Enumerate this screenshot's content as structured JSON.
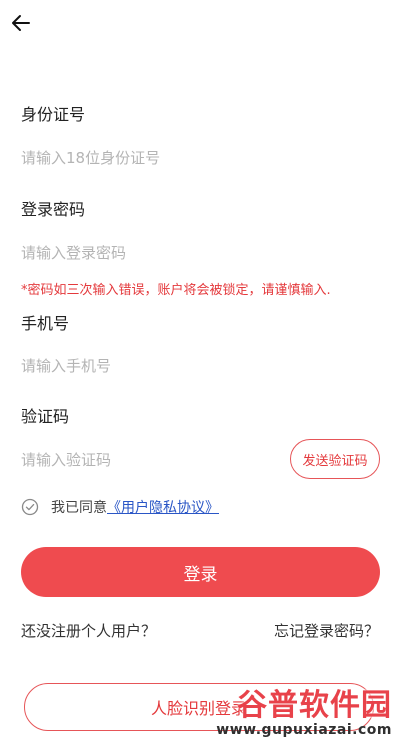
{
  "header": {
    "back_icon": "arrow-left-icon"
  },
  "form": {
    "id_label": "身份证号",
    "id_placeholder": "请输入18位身份证号",
    "password_label": "登录密码",
    "password_placeholder": "请输入登录密码",
    "password_warning": "*密码如三次输入错误，账户将会被锁定，请谨慎输入.",
    "phone_label": "手机号",
    "phone_placeholder": "请输入手机号",
    "code_label": "验证码",
    "code_placeholder": "请输入验证码",
    "send_code_label": "发送验证码"
  },
  "agreement": {
    "check_icon": "check-circle-icon",
    "prefix": "我已同意",
    "link": "《用户隐私协议》"
  },
  "actions": {
    "login_label": "登录",
    "register_link": "还没注册个人用户？",
    "forgot_link": "忘记登录密码？",
    "face_login_label": "人脸识别登录"
  },
  "watermark": {
    "logo_text": "谷普软件园",
    "url": "www.gupuxiazai.com"
  },
  "colors": {
    "accent": "#ef4b4f",
    "warning": "#e4393c",
    "link": "#2a56c6",
    "placeholder": "#b4b4b4"
  }
}
